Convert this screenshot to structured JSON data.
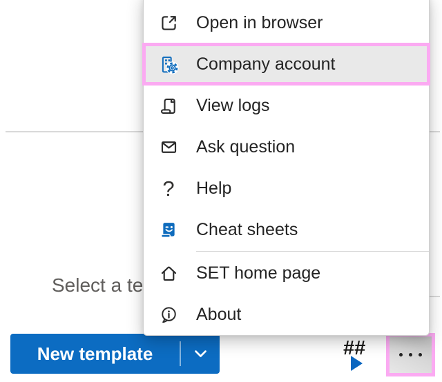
{
  "overlay_menu": {
    "items": [
      {
        "label": "Open in browser"
      },
      {
        "label": "Company account",
        "selected": true,
        "annotated": true
      },
      {
        "label": "View logs"
      },
      {
        "label": "Ask question"
      },
      {
        "label": "Help"
      },
      {
        "label": "Cheat sheets"
      },
      {
        "label": "SET home page"
      },
      {
        "label": "About"
      }
    ]
  },
  "canvas": {
    "placeholder_text": "Select a tem"
  },
  "footer": {
    "new_template": {
      "label": "New template"
    },
    "hash_marker": {
      "label": "##"
    }
  },
  "colors": {
    "accent_blue": "#0f6cbd",
    "button_blue": "#0c6cc2",
    "annotation_pink": "#fbaaf2",
    "selected_item_bg": "#e9e9e9",
    "menu_text": "#242424",
    "muted_text": "#605e5c",
    "divider": "#d9d9d9"
  }
}
